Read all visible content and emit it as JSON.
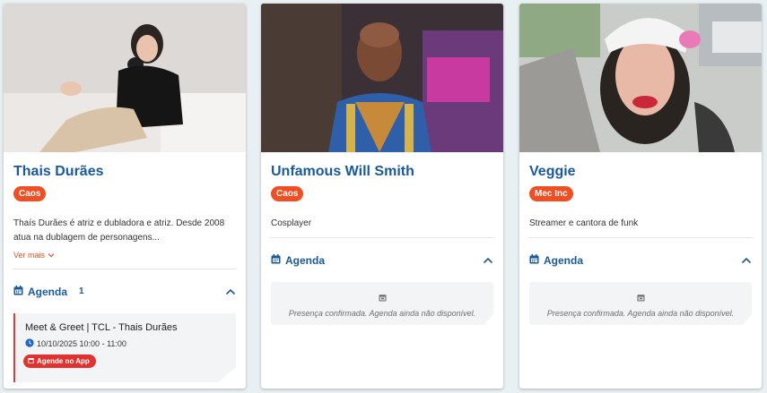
{
  "cards": [
    {
      "name": "Thais Durães",
      "badge": "Caos",
      "bio": "Thaís Durães é atriz e dubladora e atriz. Desde 2008 atua na dublagem de personagens...",
      "more_label": "Ver mais",
      "agenda_label": "Agenda",
      "agenda_count": "1",
      "event": {
        "title": "Meet & Greet | TCL - Thais Durães",
        "time": "10/10/2025 10:00 - 11:00",
        "button_label": "Agende no App"
      }
    },
    {
      "name": "Unfamous Will Smith",
      "badge": "Caos",
      "bio": "Cosplayer",
      "agenda_label": "Agenda",
      "empty_message": "Presença confirmada. Agenda ainda não disponível."
    },
    {
      "name": "Veggie",
      "badge": "Mec Inc",
      "bio": "Streamer e cantora de funk",
      "agenda_label": "Agenda",
      "empty_message": "Presença confirmada. Agenda ainda não disponível."
    }
  ],
  "colors": {
    "accent": "#1a5a9a",
    "badge": "#f04e23",
    "event_border": "#d93a3a",
    "app_button": "#e0322f"
  },
  "icons": [
    "calendar-icon",
    "chevron-up-icon",
    "chevron-down-icon",
    "clock-icon"
  ]
}
